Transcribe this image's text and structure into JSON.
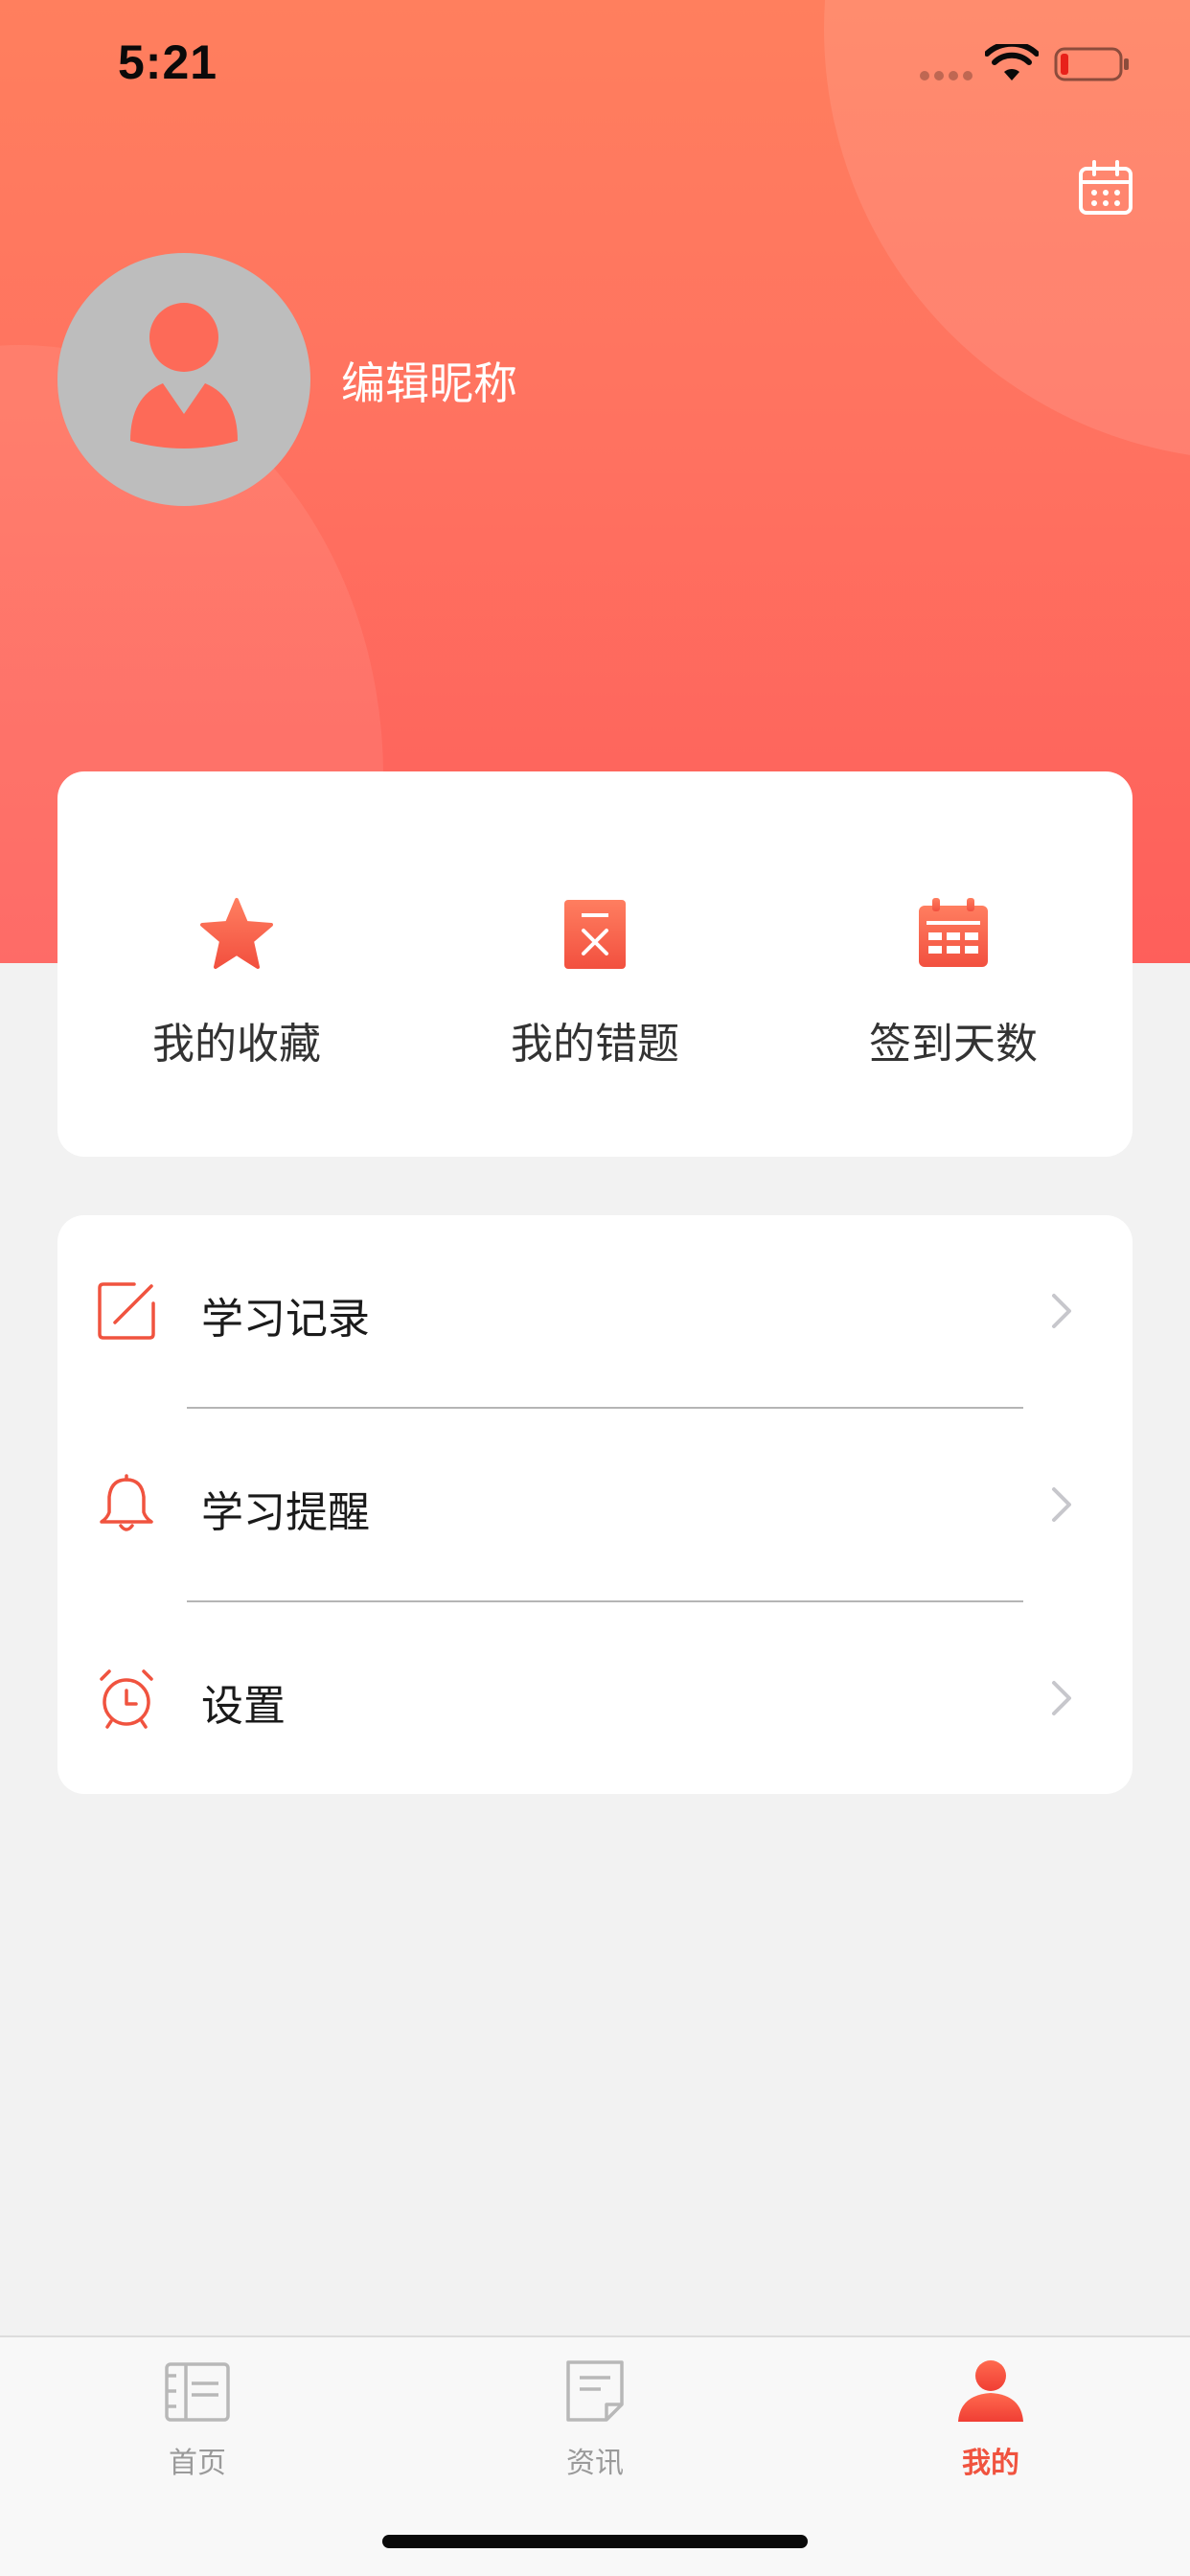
{
  "status_bar": {
    "time": "5:21"
  },
  "profile": {
    "nickname": "编辑昵称"
  },
  "quick_actions": [
    {
      "label": "我的收藏",
      "icon": "star-icon"
    },
    {
      "label": "我的错题",
      "icon": "wrong-question-icon"
    },
    {
      "label": "签到天数",
      "icon": "calendar-icon"
    }
  ],
  "menu": [
    {
      "label": "学习记录",
      "icon": "edit-icon"
    },
    {
      "label": "学习提醒",
      "icon": "bell-icon"
    },
    {
      "label": "设置",
      "icon": "alarm-clock-icon"
    }
  ],
  "tabs": [
    {
      "label": "首页",
      "icon": "book-icon",
      "active": false
    },
    {
      "label": "资讯",
      "icon": "document-icon",
      "active": false
    },
    {
      "label": "我的",
      "icon": "user-icon",
      "active": true
    }
  ],
  "colors": {
    "accent": "#f0533f",
    "gradient_top": "#ff7f5e",
    "gradient_bottom": "#fe5f5b",
    "icon_inactive": "#b8b8b8"
  }
}
